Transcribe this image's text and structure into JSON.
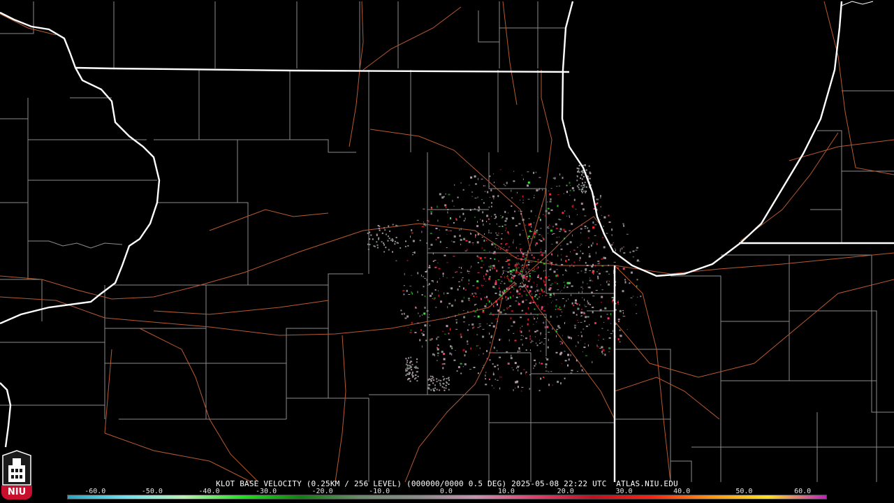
{
  "caption": {
    "text": "KLOT BASE VELOCITY (0.25KM / 256 LEVEL) (000000/0000 0.5 DEG) 2025-05-08 22:22 UTC  ATLAS.NIU.EDU"
  },
  "legend": {
    "labels": [
      "-60.0",
      "-50.0",
      "-40.0",
      "-30.0",
      "-20.0",
      "-10.0",
      "0.0",
      "10.0",
      "20.0",
      "30.0",
      "40.0",
      "50.0",
      "60.0"
    ],
    "colors": [
      "#2aa5c0",
      "#6fe0f0",
      "#b8f0b0",
      "#20e020",
      "#108010",
      "#6a8a6a",
      "#8a8a8a",
      "#c890b0",
      "#e04070",
      "#c01020",
      "#ff2010",
      "#ff9010",
      "#ffe020",
      "#c020c0"
    ]
  },
  "logo": {
    "text": "NIU"
  },
  "colors": {
    "background": "#000000",
    "state_border": "#ffffff",
    "county_line": "#8c8c8c",
    "highway": "#b85a30"
  }
}
